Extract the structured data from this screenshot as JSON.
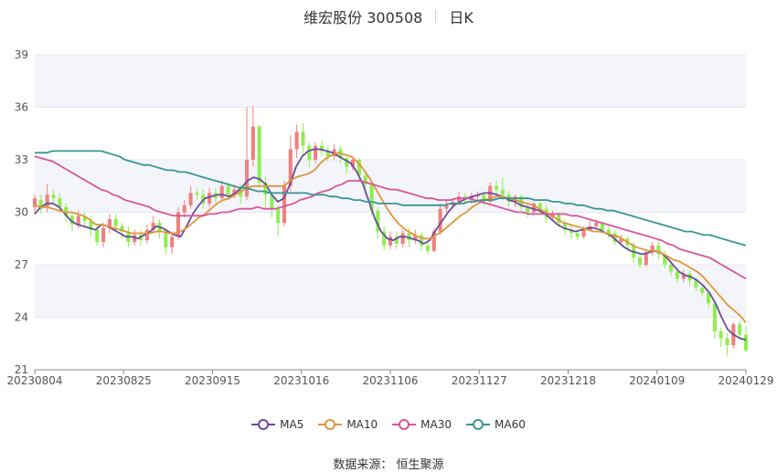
{
  "title": {
    "name": "维宏股份 300508",
    "period": "日K"
  },
  "source": "数据来源： 恒生聚源",
  "colors": {
    "up": "#f08080",
    "down": "#90ee50",
    "ma5": "#6a4c9c",
    "ma10": "#e0953c",
    "ma30": "#d8559c",
    "ma60": "#3a9494",
    "band": "#f4f5fb",
    "grid": "#e6e8f0"
  },
  "chart_data": {
    "type": "candlestick",
    "xlabels": [
      "20230804",
      "20230825",
      "20230915",
      "20231016",
      "20231106",
      "20231127",
      "20231218",
      "20240109",
      "20240129"
    ],
    "ylim": [
      21,
      39
    ],
    "yticks": [
      21,
      24,
      27,
      30,
      33,
      36,
      39
    ],
    "legend": [
      {
        "key": "ma5",
        "label": "MA5"
      },
      {
        "key": "ma10",
        "label": "MA10"
      },
      {
        "key": "ma30",
        "label": "MA30"
      },
      {
        "key": "ma60",
        "label": "MA60"
      }
    ],
    "candles_approx": [
      [
        30.3,
        30.8,
        29.9,
        31.0
      ],
      [
        30.7,
        30.2,
        29.9,
        31.0
      ],
      [
        30.3,
        31.0,
        30.0,
        31.6
      ],
      [
        31.0,
        30.8,
        30.5,
        31.3
      ],
      [
        30.8,
        30.3,
        30.0,
        31.1
      ],
      [
        30.3,
        29.8,
        29.4,
        30.5
      ],
      [
        29.8,
        29.3,
        28.9,
        30.0
      ],
      [
        29.3,
        29.8,
        29.1,
        30.1
      ],
      [
        29.8,
        29.5,
        29.1,
        30.0
      ],
      [
        29.5,
        29.0,
        28.6,
        29.8
      ],
      [
        29.0,
        28.3,
        28.1,
        29.3
      ],
      [
        28.3,
        29.1,
        28.0,
        29.4
      ],
      [
        29.1,
        29.6,
        28.8,
        29.9
      ],
      [
        29.6,
        29.2,
        28.9,
        29.9
      ],
      [
        29.2,
        28.9,
        28.5,
        29.4
      ],
      [
        28.9,
        28.3,
        28.0,
        29.2
      ],
      [
        28.3,
        28.7,
        28.1,
        29.0
      ],
      [
        28.7,
        28.4,
        28.1,
        29.0
      ],
      [
        28.4,
        29.0,
        28.2,
        29.3
      ],
      [
        29.0,
        29.4,
        28.8,
        29.8
      ],
      [
        29.4,
        28.9,
        28.5,
        29.6
      ],
      [
        28.9,
        28.0,
        27.6,
        29.1
      ],
      [
        28.0,
        28.6,
        27.6,
        28.9
      ],
      [
        28.6,
        30.0,
        28.4,
        30.3
      ],
      [
        30.0,
        30.4,
        29.7,
        30.7
      ],
      [
        30.4,
        31.1,
        30.2,
        31.5
      ],
      [
        31.1,
        31.0,
        30.7,
        31.4
      ],
      [
        31.0,
        30.5,
        30.2,
        31.3
      ],
      [
        30.5,
        31.1,
        30.3,
        31.4
      ],
      [
        31.1,
        30.8,
        30.5,
        31.4
      ],
      [
        30.8,
        31.5,
        30.6,
        31.8
      ],
      [
        31.5,
        31.0,
        30.7,
        31.7
      ],
      [
        31.0,
        31.3,
        30.8,
        31.6
      ],
      [
        31.3,
        30.9,
        30.5,
        31.6
      ],
      [
        30.9,
        33.0,
        30.7,
        36.0
      ],
      [
        33.0,
        34.9,
        32.6,
        36.1
      ],
      [
        34.9,
        31.7,
        31.4,
        35.0
      ],
      [
        31.7,
        31.0,
        30.3,
        32.0
      ],
      [
        31.0,
        30.2,
        29.7,
        31.2
      ],
      [
        30.2,
        29.4,
        28.6,
        30.4
      ],
      [
        29.4,
        31.5,
        29.2,
        31.8
      ],
      [
        31.5,
        33.6,
        31.2,
        34.4
      ],
      [
        33.6,
        34.6,
        33.1,
        35.0
      ],
      [
        34.6,
        33.8,
        33.3,
        35.1
      ],
      [
        33.8,
        33.0,
        32.6,
        34.0
      ],
      [
        33.0,
        33.8,
        32.8,
        34.0
      ],
      [
        33.8,
        33.5,
        33.2,
        34.1
      ],
      [
        33.5,
        33.2,
        32.9,
        33.8
      ],
      [
        33.2,
        33.6,
        33.0,
        33.9
      ],
      [
        33.6,
        33.1,
        32.8,
        33.8
      ],
      [
        33.1,
        32.6,
        32.2,
        33.3
      ],
      [
        32.6,
        33.0,
        32.4,
        33.2
      ],
      [
        33.0,
        32.1,
        31.8,
        33.1
      ],
      [
        32.1,
        31.6,
        31.0,
        32.3
      ],
      [
        31.6,
        30.1,
        29.8,
        31.7
      ],
      [
        30.1,
        28.9,
        28.5,
        30.3
      ],
      [
        28.9,
        28.1,
        27.8,
        29.2
      ],
      [
        28.1,
        28.6,
        27.9,
        28.9
      ],
      [
        28.6,
        28.2,
        27.9,
        28.9
      ],
      [
        28.2,
        28.8,
        28.0,
        29.0
      ],
      [
        28.8,
        28.4,
        28.0,
        29.1
      ],
      [
        28.4,
        28.7,
        28.2,
        29.0
      ],
      [
        28.7,
        28.1,
        27.8,
        28.9
      ],
      [
        28.1,
        27.8,
        27.6,
        28.3
      ],
      [
        27.8,
        28.9,
        27.7,
        29.1
      ],
      [
        28.9,
        30.2,
        28.7,
        30.5
      ],
      [
        30.2,
        30.4,
        30.0,
        30.7
      ],
      [
        30.4,
        30.6,
        30.2,
        30.8
      ],
      [
        30.6,
        30.9,
        30.4,
        31.2
      ],
      [
        30.9,
        30.7,
        30.4,
        31.1
      ],
      [
        30.7,
        30.9,
        30.5,
        31.1
      ],
      [
        30.9,
        31.0,
        30.7,
        31.2
      ],
      [
        31.0,
        30.6,
        30.4,
        31.1
      ],
      [
        30.6,
        31.5,
        30.5,
        31.7
      ],
      [
        31.5,
        31.3,
        31.0,
        31.8
      ],
      [
        31.3,
        31.0,
        30.7,
        32.0
      ],
      [
        31.0,
        30.6,
        30.3,
        31.2
      ],
      [
        30.6,
        30.9,
        30.3,
        31.0
      ],
      [
        30.9,
        30.3,
        30.0,
        31.0
      ],
      [
        30.3,
        30.0,
        29.7,
        30.5
      ],
      [
        30.0,
        30.5,
        29.8,
        30.6
      ],
      [
        30.5,
        30.2,
        29.9,
        30.6
      ],
      [
        30.2,
        29.7,
        29.4,
        30.4
      ],
      [
        29.7,
        29.9,
        29.6,
        30.1
      ],
      [
        29.9,
        29.4,
        29.1,
        30.0
      ],
      [
        29.4,
        29.0,
        28.7,
        29.6
      ],
      [
        29.0,
        28.8,
        28.5,
        29.3
      ],
      [
        28.8,
        28.6,
        28.4,
        29.0
      ],
      [
        28.6,
        29.0,
        28.5,
        29.2
      ],
      [
        29.0,
        29.2,
        28.9,
        29.5
      ],
      [
        29.2,
        29.4,
        29.0,
        29.6
      ],
      [
        29.4,
        29.0,
        28.8,
        29.5
      ],
      [
        29.0,
        28.8,
        28.5,
        29.2
      ],
      [
        28.8,
        28.3,
        28.1,
        29.0
      ],
      [
        28.3,
        28.5,
        28.1,
        28.7
      ],
      [
        28.5,
        28.1,
        27.8,
        28.6
      ],
      [
        28.1,
        27.4,
        27.1,
        28.3
      ],
      [
        27.4,
        27.0,
        26.8,
        27.6
      ],
      [
        27.0,
        27.7,
        26.9,
        27.8
      ],
      [
        27.7,
        28.1,
        27.5,
        28.3
      ],
      [
        28.1,
        27.6,
        27.3,
        28.4
      ],
      [
        27.6,
        27.0,
        26.8,
        27.8
      ],
      [
        27.0,
        26.6,
        26.4,
        27.2
      ],
      [
        26.6,
        26.2,
        26.0,
        26.8
      ],
      [
        26.2,
        26.5,
        26.0,
        26.7
      ],
      [
        26.5,
        26.1,
        25.8,
        26.7
      ],
      [
        26.1,
        25.7,
        25.5,
        26.3
      ],
      [
        25.7,
        25.4,
        25.2,
        25.9
      ],
      [
        25.4,
        24.8,
        24.5,
        25.5
      ],
      [
        24.8,
        23.2,
        22.8,
        24.9
      ],
      [
        23.2,
        22.8,
        22.3,
        23.4
      ],
      [
        22.8,
        22.4,
        21.8,
        23.1
      ],
      [
        22.4,
        23.6,
        22.2,
        23.7
      ],
      [
        23.6,
        23.0,
        22.7,
        23.8
      ],
      [
        23.0,
        22.1,
        22.0,
        23.5
      ]
    ],
    "series": [
      {
        "name": "MA5",
        "values": [
          29.9,
          30.3,
          30.5,
          30.5,
          30.3,
          29.9,
          29.5,
          29.3,
          29.2,
          29.1,
          29.0,
          29.3,
          29.2,
          29.0,
          28.8,
          28.6,
          28.6,
          28.5,
          28.7,
          28.9,
          29.2,
          29.1,
          28.9,
          28.7,
          28.6,
          29.2,
          29.9,
          30.4,
          30.8,
          30.9,
          31.0,
          31.0,
          30.9,
          31.1,
          31.4,
          31.8,
          32.0,
          31.9,
          31.6,
          31.0,
          30.6,
          30.8,
          31.6,
          32.6,
          33.2,
          33.5,
          33.6,
          33.6,
          33.5,
          33.4,
          33.2,
          33.0,
          32.8,
          32.3,
          31.6,
          30.6,
          29.6,
          28.9,
          28.5,
          28.4,
          28.6,
          28.6,
          28.5,
          28.4,
          28.2,
          28.4,
          29.0,
          29.5,
          30.0,
          30.4,
          30.6,
          30.8,
          30.9,
          31.0,
          31.1,
          31.1,
          31.0,
          30.9,
          30.7,
          30.6,
          30.4,
          30.3,
          30.2,
          30.1,
          29.9,
          29.6,
          29.3,
          29.1,
          29.0,
          28.9,
          29.0,
          29.1,
          29.1,
          29.0,
          28.8,
          28.6,
          28.3,
          28.0,
          27.8,
          27.7,
          27.6,
          27.7,
          27.8,
          27.7,
          27.4,
          27.0,
          26.6,
          26.4,
          26.3,
          26.1,
          25.8,
          25.4,
          24.8,
          24.0,
          23.3,
          23.0,
          22.8,
          22.7
        ]
      },
      {
        "name": "MA10",
        "values": [
          30.4,
          30.3,
          30.3,
          30.2,
          30.1,
          30.0,
          30.0,
          29.9,
          29.8,
          29.6,
          29.3,
          29.3,
          29.2,
          29.1,
          29.0,
          28.9,
          28.8,
          28.8,
          28.8,
          28.8,
          28.9,
          28.9,
          28.8,
          28.8,
          28.9,
          29.1,
          29.4,
          29.7,
          29.9,
          30.2,
          30.5,
          30.7,
          30.8,
          31.0,
          31.2,
          31.4,
          31.5,
          31.5,
          31.5,
          31.5,
          31.5,
          31.5,
          31.8,
          32.0,
          32.1,
          32.2,
          32.4,
          32.8,
          33.1,
          33.3,
          33.4,
          33.3,
          33.2,
          32.9,
          32.5,
          32.0,
          31.4,
          30.8,
          30.2,
          29.7,
          29.3,
          29.0,
          28.8,
          28.6,
          28.5,
          28.5,
          28.7,
          28.9,
          29.2,
          29.5,
          29.8,
          30.0,
          30.3,
          30.5,
          30.7,
          30.8,
          30.9,
          30.9,
          30.8,
          30.7,
          30.6,
          30.5,
          30.4,
          30.2,
          30.0,
          29.8,
          29.6,
          29.4,
          29.3,
          29.2,
          29.1,
          29.0,
          28.9,
          28.9,
          28.8,
          28.7,
          28.6,
          28.4,
          28.2,
          28.0,
          27.9,
          27.8,
          27.8,
          27.7,
          27.5,
          27.3,
          27.2,
          27.0,
          26.8,
          26.6,
          26.3,
          25.9,
          25.5,
          25.1,
          24.7,
          24.4,
          24.1,
          23.7
        ]
      },
      {
        "name": "MA30",
        "values": [
          33.2,
          33.1,
          33.0,
          32.9,
          32.7,
          32.5,
          32.3,
          32.1,
          31.9,
          31.7,
          31.5,
          31.3,
          31.2,
          31.0,
          30.9,
          30.7,
          30.6,
          30.5,
          30.4,
          30.3,
          30.1,
          30.0,
          29.9,
          29.8,
          29.8,
          29.8,
          29.8,
          29.8,
          29.8,
          29.9,
          29.9,
          30.0,
          30.0,
          30.1,
          30.2,
          30.2,
          30.2,
          30.3,
          30.2,
          30.2,
          30.2,
          30.3,
          30.4,
          30.5,
          30.7,
          30.8,
          30.9,
          31.1,
          31.2,
          31.3,
          31.5,
          31.6,
          31.8,
          31.8,
          31.8,
          31.7,
          31.6,
          31.5,
          31.4,
          31.3,
          31.3,
          31.2,
          31.1,
          31.0,
          30.9,
          30.8,
          30.8,
          30.7,
          30.7,
          30.7,
          30.8,
          30.8,
          30.8,
          30.7,
          30.6,
          30.5,
          30.4,
          30.3,
          30.2,
          30.1,
          30.0,
          30.0,
          29.9,
          29.9,
          29.9,
          29.9,
          29.9,
          29.9,
          29.9,
          29.8,
          29.8,
          29.7,
          29.6,
          29.5,
          29.4,
          29.3,
          29.2,
          29.1,
          29.0,
          28.9,
          28.8,
          28.7,
          28.6,
          28.5,
          28.4,
          28.2,
          28.1,
          27.9,
          27.8,
          27.7,
          27.6,
          27.5,
          27.4,
          27.2,
          27.0,
          26.8,
          26.6,
          26.4,
          26.2
        ]
      },
      {
        "name": "MA60",
        "values": [
          33.4,
          33.4,
          33.4,
          33.5,
          33.5,
          33.5,
          33.5,
          33.5,
          33.5,
          33.5,
          33.5,
          33.5,
          33.4,
          33.3,
          33.2,
          33.0,
          32.9,
          32.8,
          32.7,
          32.7,
          32.6,
          32.5,
          32.4,
          32.4,
          32.3,
          32.3,
          32.2,
          32.1,
          32.0,
          31.9,
          31.8,
          31.7,
          31.6,
          31.5,
          31.4,
          31.4,
          31.3,
          31.2,
          31.2,
          31.1,
          31.1,
          31.1,
          31.1,
          31.1,
          31.1,
          31.1,
          31.0,
          31.0,
          31.0,
          30.9,
          30.9,
          30.8,
          30.8,
          30.7,
          30.7,
          30.6,
          30.6,
          30.5,
          30.5,
          30.5,
          30.5,
          30.4,
          30.4,
          30.4,
          30.4,
          30.4,
          30.4,
          30.4,
          30.4,
          30.5,
          30.5,
          30.5,
          30.6,
          30.6,
          30.7,
          30.7,
          30.7,
          30.8,
          30.8,
          30.8,
          30.8,
          30.8,
          30.8,
          30.7,
          30.7,
          30.7,
          30.6,
          30.6,
          30.5,
          30.5,
          30.4,
          30.4,
          30.3,
          30.2,
          30.2,
          30.1,
          30.1,
          30.0,
          29.9,
          29.8,
          29.7,
          29.6,
          29.5,
          29.4,
          29.3,
          29.2,
          29.1,
          29.0,
          28.9,
          28.9,
          28.8,
          28.7,
          28.7,
          28.6,
          28.5,
          28.4,
          28.3,
          28.2,
          28.1
        ]
      }
    ]
  }
}
